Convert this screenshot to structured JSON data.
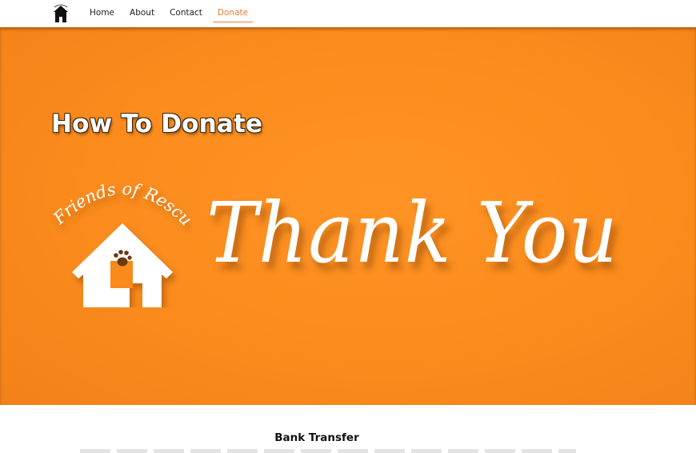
{
  "nav": {
    "logo_icon": "house-logo-icon",
    "links": [
      {
        "label": "Home"
      },
      {
        "label": "About"
      },
      {
        "label": "Contact"
      },
      {
        "label": "Donate"
      }
    ],
    "active_color": "#f07a3c"
  },
  "hero": {
    "title": "How To Donate",
    "logo_text": "Friends of Rescue",
    "logo_icon": "house-paw-icon",
    "banner_text": "Thank You",
    "background_color": "#fb8b1c"
  },
  "section": {
    "title": "Bank Transfer"
  }
}
